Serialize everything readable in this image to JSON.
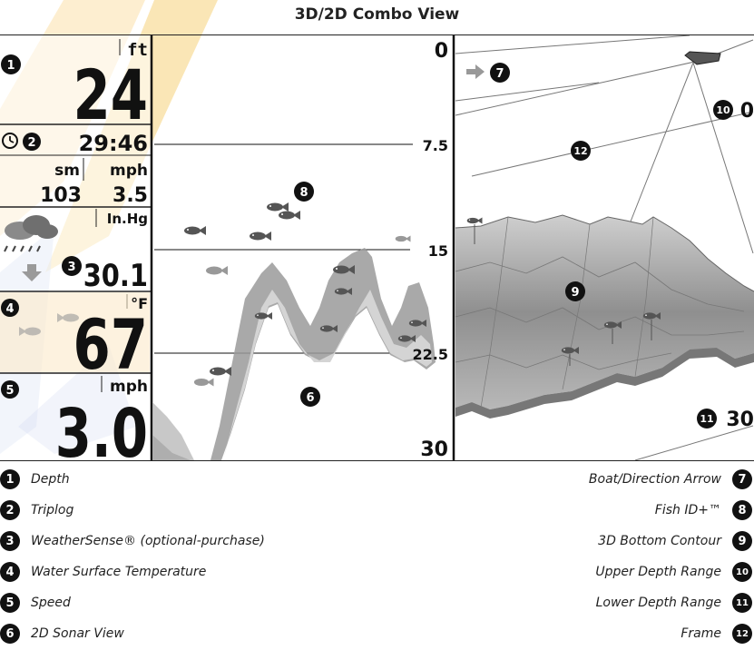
{
  "title": "3D/2D Combo View",
  "sidebar": {
    "depth_unit": "ft",
    "depth_value": "24",
    "triplog_time": "29:46",
    "distance_unit": "sm",
    "speed_unit_top": "mph",
    "distance_value": "103",
    "avg_speed_value": "3.5",
    "pressure_unit": "In.Hg",
    "pressure_value": "30.1",
    "temp_unit": "°F",
    "temp_value": "67",
    "speed_unit": "mph",
    "speed_value": "3.0"
  },
  "sonar": {
    "depth_top": "0",
    "depth_1": "7.5",
    "depth_2": "15",
    "depth_3": "22.5",
    "depth_bottom": "30"
  },
  "view3d": {
    "upper_range": "0",
    "lower_range": "30"
  },
  "callouts": {
    "c1": "1",
    "c2": "2",
    "c3": "3",
    "c4": "4",
    "c5": "5",
    "c6": "6",
    "c7": "7",
    "c8": "8",
    "c9": "9",
    "c10": "10",
    "c11": "11",
    "c12": "12"
  },
  "legend_left": [
    {
      "num": "1",
      "label": "Depth"
    },
    {
      "num": "2",
      "label": "Triplog"
    },
    {
      "num": "3",
      "label": "WeatherSense® (optional-purchase)"
    },
    {
      "num": "4",
      "label": "Water Surface Temperature"
    },
    {
      "num": "5",
      "label": "Speed"
    },
    {
      "num": "6",
      "label": "2D Sonar View"
    }
  ],
  "legend_right": [
    {
      "num": "7",
      "label": "Boat/Direction Arrow"
    },
    {
      "num": "8",
      "label": "Fish ID+™"
    },
    {
      "num": "9",
      "label": "3D Bottom Contour"
    },
    {
      "num": "10",
      "label": "Upper Depth Range"
    },
    {
      "num": "11",
      "label": "Lower Depth Range"
    },
    {
      "num": "12",
      "label": "Frame"
    }
  ],
  "colors": {
    "watermark_yellow": "#f6d27a",
    "watermark_blue": "#8aa0d8",
    "sidebar_tint": "#fbe9c9",
    "sonar_bottom": "#8c8c8c",
    "fish": "#555555"
  }
}
